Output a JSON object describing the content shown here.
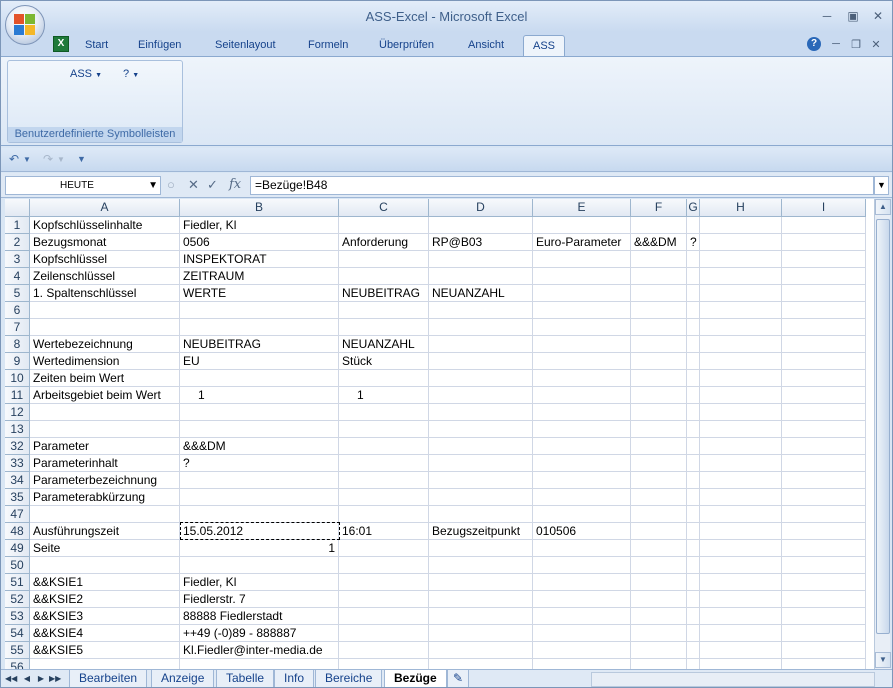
{
  "window": {
    "title": "ASS-Excel - Microsoft Excel"
  },
  "ribbon_tabs": [
    {
      "label": "Start"
    },
    {
      "label": "Einfügen"
    },
    {
      "label": "Seitenlayout"
    },
    {
      "label": "Formeln"
    },
    {
      "label": "Überprüfen"
    },
    {
      "label": "Ansicht"
    },
    {
      "label": "ASS"
    }
  ],
  "ribbon": {
    "ass_menu": "ASS",
    "help_menu": "?",
    "group_label": "Benutzerdefinierte Symbolleisten"
  },
  "formula_bar": {
    "name_box": "HEUTE",
    "formula": "=Bezüge!B48"
  },
  "columns": [
    "A",
    "B",
    "C",
    "D",
    "E",
    "F",
    "G",
    "H",
    "I"
  ],
  "rows": [
    {
      "num": "1",
      "A": "Kopfschlüsselinhalte",
      "B": "Fiedler, Kl"
    },
    {
      "num": "2",
      "A": "Bezugsmonat",
      "B": "0506",
      "C": "Anforderung",
      "D": "RP@B03",
      "E": "Euro-Parameter",
      "F": "&&&DM",
      "G": "?"
    },
    {
      "num": "3",
      "A": "Kopfschlüssel",
      "B": "INSPEKTORAT"
    },
    {
      "num": "4",
      "A": "Zeilenschlüssel",
      "B": "ZEITRAUM"
    },
    {
      "num": "5",
      "A": "1. Spaltenschlüssel",
      "B": "WERTE",
      "C": "NEUBEITRAG",
      "D": "NEUANZAHL"
    },
    {
      "num": "6"
    },
    {
      "num": "7"
    },
    {
      "num": "8",
      "A": "Wertebezeichnung",
      "B": "NEUBEITRAG",
      "C": "NEUANZAHL"
    },
    {
      "num": "9",
      "A": "Wertedimension",
      "B": "EU",
      "C": "Stück"
    },
    {
      "num": "10",
      "A": "Zeiten beim Wert"
    },
    {
      "num": "11",
      "A": "Arbeitsgebiet beim Wert",
      "B": "1",
      "C": "1"
    },
    {
      "num": "12"
    },
    {
      "num": "13"
    },
    {
      "num": "32",
      "A": "Parameter",
      "B": "&&&DM"
    },
    {
      "num": "33",
      "A": "Parameterinhalt",
      "B": "?"
    },
    {
      "num": "34",
      "A": "Parameterbezeichnung"
    },
    {
      "num": "35",
      "A": "Parameterabkürzung"
    },
    {
      "num": "47"
    },
    {
      "num": "48",
      "A": "Ausführungszeit",
      "B": "15.05.2012",
      "C": "16:01",
      "D": "Bezugszeitpunkt",
      "E": "010506"
    },
    {
      "num": "49",
      "A": "Seite",
      "B": "1"
    },
    {
      "num": "50"
    },
    {
      "num": "51",
      "A": "&&KSIE1",
      "B": "Fiedler, Kl"
    },
    {
      "num": "52",
      "A": "&&KSIE2",
      "B": "Fiedlerstr. 7"
    },
    {
      "num": "53",
      "A": "&&KSIE3",
      "B": "88888 Fiedlerstadt"
    },
    {
      "num": "54",
      "A": "&&KSIE4",
      "B": "++49 (-0)89 - 888887"
    },
    {
      "num": "55",
      "A": "&&KSIE5",
      "B": "Kl.Fiedler@inter-media.de"
    },
    {
      "num": "56"
    }
  ],
  "sheet_tabs": [
    {
      "label": "Bearbeiten"
    },
    {
      "label": "Anzeige"
    },
    {
      "label": "Tabelle"
    },
    {
      "label": "Info"
    },
    {
      "label": "Bereiche"
    },
    {
      "label": "Bezüge"
    }
  ],
  "active_sheet": "Bezüge"
}
